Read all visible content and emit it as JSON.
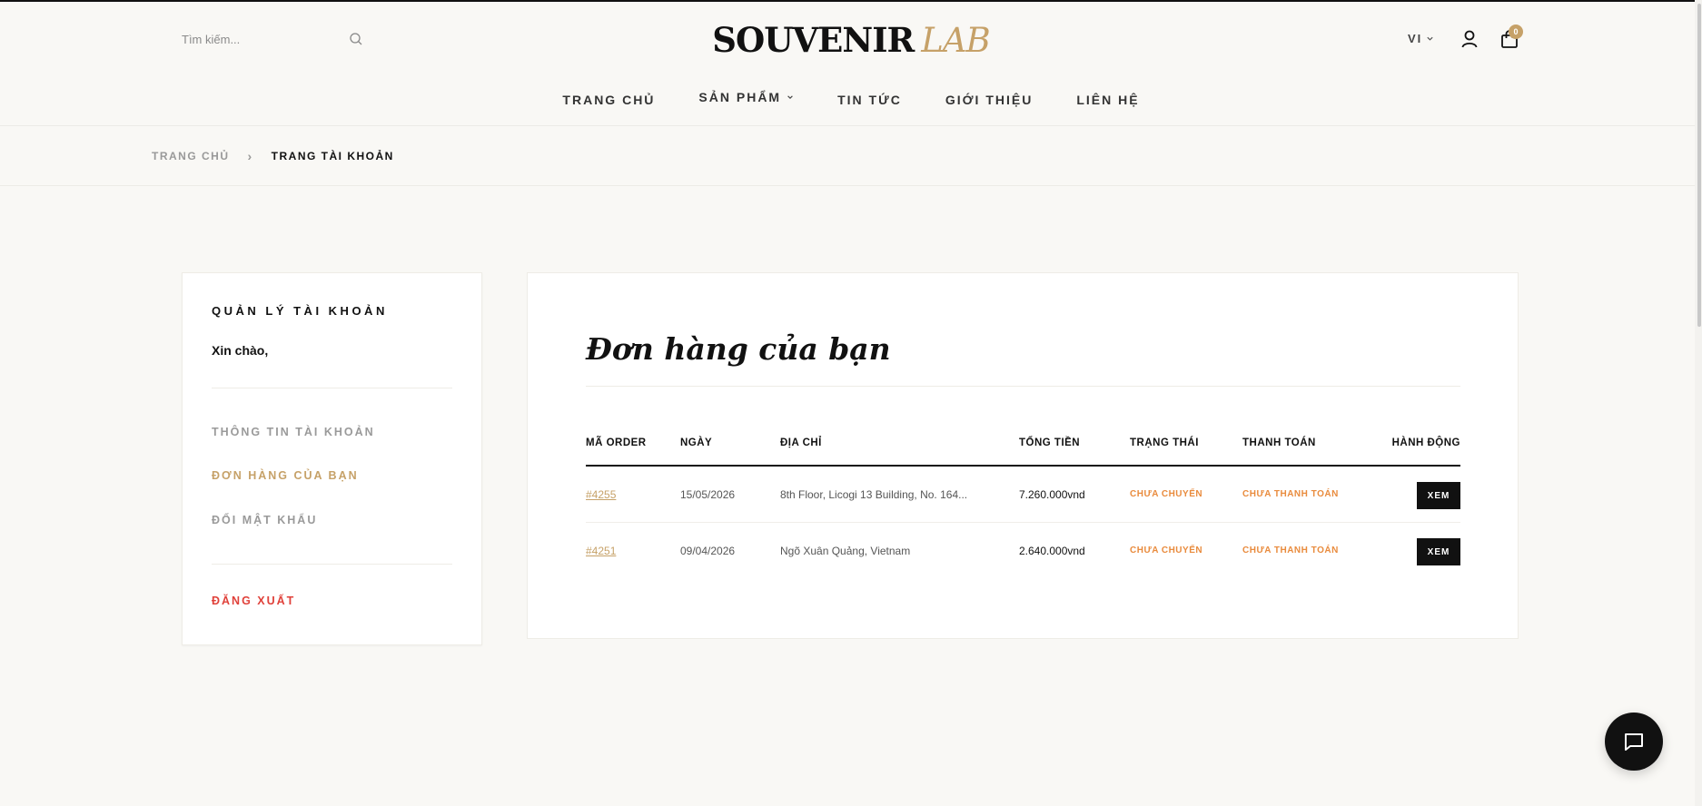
{
  "header": {
    "search_placeholder": "Tìm kiếm...",
    "logo_main": "SOUVENIR",
    "logo_accent": "LAB",
    "lang": "VI",
    "cart_count": "0"
  },
  "nav": {
    "items": [
      {
        "label": "TRANG CHỦ"
      },
      {
        "label": "SẢN PHẨM"
      },
      {
        "label": "TIN TỨC"
      },
      {
        "label": "GIỚI THIỆU"
      },
      {
        "label": "LIÊN HỆ"
      }
    ]
  },
  "breadcrumb": {
    "home": "TRANG CHỦ",
    "current": "TRANG TÀI KHOẢN"
  },
  "sidebar": {
    "title": "QUẢN LÝ TÀI KHOẢN",
    "greeting": "Xin chào,",
    "links": [
      {
        "label": "THÔNG TIN TÀI KHOẢN"
      },
      {
        "label": "ĐƠN HÀNG CỦA BẠN"
      },
      {
        "label": "ĐỔI MẬT KHẨU"
      }
    ],
    "logout": "ĐĂNG XUẤT"
  },
  "orders": {
    "title": "Đơn hàng của bạn",
    "columns": [
      "MÃ ORDER",
      "NGÀY",
      "ĐỊA CHỈ",
      "TỔNG TIỀN",
      "TRẠNG THÁI",
      "THANH TOÁN",
      "HÀNH ĐỘNG"
    ],
    "rows": [
      {
        "id": "#4255",
        "date": "15/05/2026",
        "address": "8th Floor, Licogi 13 Building, No. 164...",
        "total": "7.260.000vnd",
        "status": "CHƯA CHUYỂN",
        "payment": "CHƯA THANH TOÁN",
        "action": "XEM"
      },
      {
        "id": "#4251",
        "date": "09/04/2026",
        "address": "Ngõ Xuân Quảng, Vietnam",
        "total": "2.640.000vnd",
        "status": "CHƯA CHUYỂN",
        "payment": "CHƯA THANH TOÁN",
        "action": "XEM"
      }
    ]
  },
  "colors": {
    "accent": "#c6a168",
    "status": "#e98b3d",
    "logout": "#e0413a",
    "background": "#f9f8f5"
  }
}
